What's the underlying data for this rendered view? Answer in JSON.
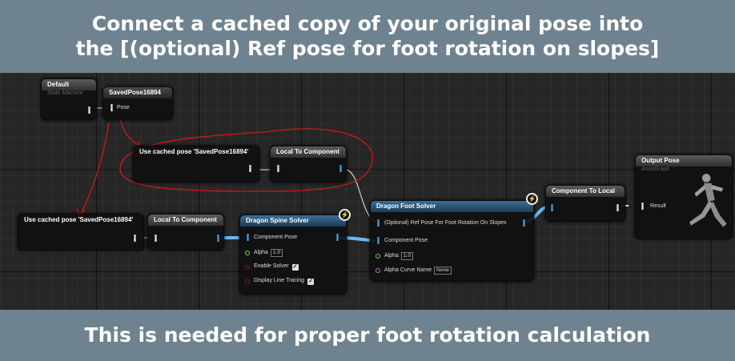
{
  "banner": {
    "top_line1": "Connect a cached copy of your original pose into",
    "top_line2": "the [(optional) Ref pose for foot rotation on slopes]",
    "bottom": "This is needed for proper foot rotation calculation"
  },
  "nodes": {
    "default_sm": {
      "title": "Default",
      "subtitle": "State Machine"
    },
    "saved_pose": {
      "title": "SavedPose16894",
      "pin_label": "Pose"
    },
    "use_cached_1": {
      "title": "Use cached pose 'SavedPose16894'"
    },
    "local_to_comp_1": {
      "title": "Local To Component"
    },
    "use_cached_2": {
      "title": "Use cached pose 'SavedPose16894'"
    },
    "local_to_comp_2": {
      "title": "Local To Component"
    },
    "spine_solver": {
      "title": "Dragon Spine Solver",
      "component_pose": "Component Pose",
      "alpha_label": "Alpha",
      "alpha_value": "1.0",
      "enable_solver": "Enable Solver",
      "display_line_tracing": "Display Line Tracing"
    },
    "foot_solver": {
      "title": "Dragon Foot Solver",
      "ref_pose": "(Optional) Ref Pose For Foot Rotation On Slopes",
      "component_pose": "Component Pose",
      "alpha_label": "Alpha",
      "alpha_value": "1.0",
      "alpha_curve_label": "Alpha Curve Name",
      "alpha_curve_value": "None"
    },
    "comp_to_local": {
      "title": "Component To Local"
    },
    "output_pose": {
      "title": "Output Pose",
      "subtitle": "AnimGraph",
      "result": "Result"
    }
  },
  "icons": {
    "bolt": "lightning-icon",
    "pose_pin": "pose-pin-icon",
    "mannequin": "mannequin-icon"
  },
  "colors": {
    "pose_wire": "#6bb8f0",
    "annotation": "#d01818",
    "banner_bg": "#6f8290"
  }
}
